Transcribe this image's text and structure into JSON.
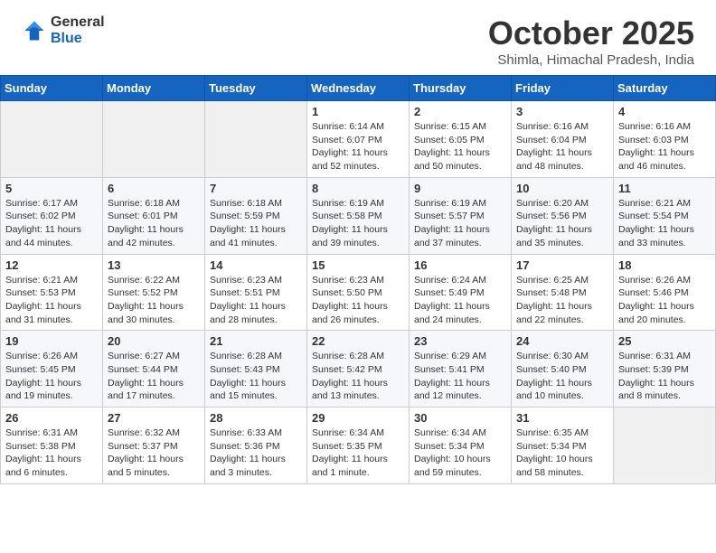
{
  "logo": {
    "general": "General",
    "blue": "Blue"
  },
  "header": {
    "title": "October 2025",
    "location": "Shimla, Himachal Pradesh, India"
  },
  "weekdays": [
    "Sunday",
    "Monday",
    "Tuesday",
    "Wednesday",
    "Thursday",
    "Friday",
    "Saturday"
  ],
  "weeks": [
    [
      {
        "day": "",
        "info": ""
      },
      {
        "day": "",
        "info": ""
      },
      {
        "day": "",
        "info": ""
      },
      {
        "day": "1",
        "info": "Sunrise: 6:14 AM\nSunset: 6:07 PM\nDaylight: 11 hours\nand 52 minutes."
      },
      {
        "day": "2",
        "info": "Sunrise: 6:15 AM\nSunset: 6:05 PM\nDaylight: 11 hours\nand 50 minutes."
      },
      {
        "day": "3",
        "info": "Sunrise: 6:16 AM\nSunset: 6:04 PM\nDaylight: 11 hours\nand 48 minutes."
      },
      {
        "day": "4",
        "info": "Sunrise: 6:16 AM\nSunset: 6:03 PM\nDaylight: 11 hours\nand 46 minutes."
      }
    ],
    [
      {
        "day": "5",
        "info": "Sunrise: 6:17 AM\nSunset: 6:02 PM\nDaylight: 11 hours\nand 44 minutes."
      },
      {
        "day": "6",
        "info": "Sunrise: 6:18 AM\nSunset: 6:01 PM\nDaylight: 11 hours\nand 42 minutes."
      },
      {
        "day": "7",
        "info": "Sunrise: 6:18 AM\nSunset: 5:59 PM\nDaylight: 11 hours\nand 41 minutes."
      },
      {
        "day": "8",
        "info": "Sunrise: 6:19 AM\nSunset: 5:58 PM\nDaylight: 11 hours\nand 39 minutes."
      },
      {
        "day": "9",
        "info": "Sunrise: 6:19 AM\nSunset: 5:57 PM\nDaylight: 11 hours\nand 37 minutes."
      },
      {
        "day": "10",
        "info": "Sunrise: 6:20 AM\nSunset: 5:56 PM\nDaylight: 11 hours\nand 35 minutes."
      },
      {
        "day": "11",
        "info": "Sunrise: 6:21 AM\nSunset: 5:54 PM\nDaylight: 11 hours\nand 33 minutes."
      }
    ],
    [
      {
        "day": "12",
        "info": "Sunrise: 6:21 AM\nSunset: 5:53 PM\nDaylight: 11 hours\nand 31 minutes."
      },
      {
        "day": "13",
        "info": "Sunrise: 6:22 AM\nSunset: 5:52 PM\nDaylight: 11 hours\nand 30 minutes."
      },
      {
        "day": "14",
        "info": "Sunrise: 6:23 AM\nSunset: 5:51 PM\nDaylight: 11 hours\nand 28 minutes."
      },
      {
        "day": "15",
        "info": "Sunrise: 6:23 AM\nSunset: 5:50 PM\nDaylight: 11 hours\nand 26 minutes."
      },
      {
        "day": "16",
        "info": "Sunrise: 6:24 AM\nSunset: 5:49 PM\nDaylight: 11 hours\nand 24 minutes."
      },
      {
        "day": "17",
        "info": "Sunrise: 6:25 AM\nSunset: 5:48 PM\nDaylight: 11 hours\nand 22 minutes."
      },
      {
        "day": "18",
        "info": "Sunrise: 6:26 AM\nSunset: 5:46 PM\nDaylight: 11 hours\nand 20 minutes."
      }
    ],
    [
      {
        "day": "19",
        "info": "Sunrise: 6:26 AM\nSunset: 5:45 PM\nDaylight: 11 hours\nand 19 minutes."
      },
      {
        "day": "20",
        "info": "Sunrise: 6:27 AM\nSunset: 5:44 PM\nDaylight: 11 hours\nand 17 minutes."
      },
      {
        "day": "21",
        "info": "Sunrise: 6:28 AM\nSunset: 5:43 PM\nDaylight: 11 hours\nand 15 minutes."
      },
      {
        "day": "22",
        "info": "Sunrise: 6:28 AM\nSunset: 5:42 PM\nDaylight: 11 hours\nand 13 minutes."
      },
      {
        "day": "23",
        "info": "Sunrise: 6:29 AM\nSunset: 5:41 PM\nDaylight: 11 hours\nand 12 minutes."
      },
      {
        "day": "24",
        "info": "Sunrise: 6:30 AM\nSunset: 5:40 PM\nDaylight: 11 hours\nand 10 minutes."
      },
      {
        "day": "25",
        "info": "Sunrise: 6:31 AM\nSunset: 5:39 PM\nDaylight: 11 hours\nand 8 minutes."
      }
    ],
    [
      {
        "day": "26",
        "info": "Sunrise: 6:31 AM\nSunset: 5:38 PM\nDaylight: 11 hours\nand 6 minutes."
      },
      {
        "day": "27",
        "info": "Sunrise: 6:32 AM\nSunset: 5:37 PM\nDaylight: 11 hours\nand 5 minutes."
      },
      {
        "day": "28",
        "info": "Sunrise: 6:33 AM\nSunset: 5:36 PM\nDaylight: 11 hours\nand 3 minutes."
      },
      {
        "day": "29",
        "info": "Sunrise: 6:34 AM\nSunset: 5:35 PM\nDaylight: 11 hours\nand 1 minute."
      },
      {
        "day": "30",
        "info": "Sunrise: 6:34 AM\nSunset: 5:34 PM\nDaylight: 10 hours\nand 59 minutes."
      },
      {
        "day": "31",
        "info": "Sunrise: 6:35 AM\nSunset: 5:34 PM\nDaylight: 10 hours\nand 58 minutes."
      },
      {
        "day": "",
        "info": ""
      }
    ]
  ]
}
